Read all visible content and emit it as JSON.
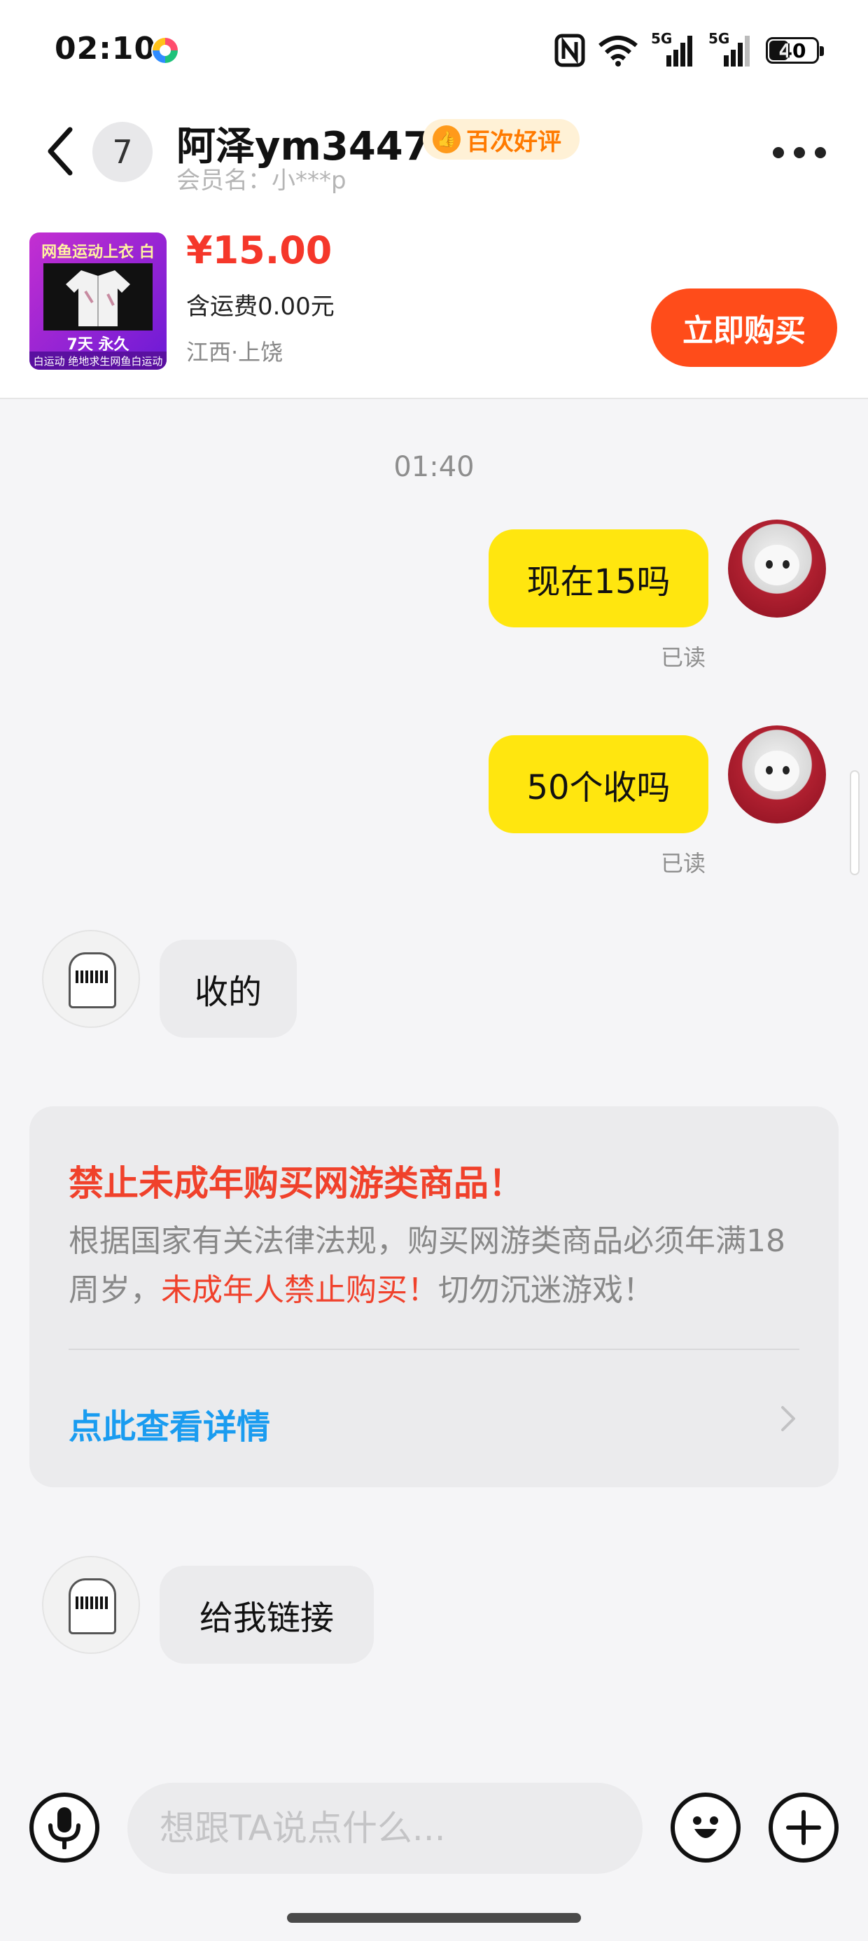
{
  "status_bar": {
    "time": "02:10",
    "battery": "40",
    "network_1": "5G",
    "network_2": "5G",
    "icons": [
      "nfc-icon",
      "wifi-icon",
      "signal-5g-icon",
      "signal-5g-icon",
      "battery-icon"
    ]
  },
  "header": {
    "back_icon": "chevron-left-icon",
    "unread_count": "7",
    "contact_name": "阿泽ym3447",
    "praise_badge": "百次好评",
    "member_name": "会员名：小***p",
    "more_icon": "more-dots-icon"
  },
  "product": {
    "thumb_top": "网鱼运动上衣 白",
    "thumb_mid": "7天  永久",
    "thumb_bottom": "白运动 绝地求生网鱼白运动",
    "price": "¥15.00",
    "shipping": "含运费0.00元",
    "location": "江西·上饶",
    "buy_label": "立即购买"
  },
  "chat": {
    "time": "01:40",
    "messages": [
      {
        "from": "self",
        "text": "现在15吗",
        "read": "已读"
      },
      {
        "from": "self",
        "text": "50个收吗",
        "read": "已读"
      },
      {
        "from": "other",
        "text": "收的"
      },
      {
        "from": "other",
        "text": "给我链接"
      }
    ]
  },
  "notice": {
    "title": "禁止未成年购买网游类商品！",
    "body_before": "根据国家有关法律法规，购买网游类商品必须年满18周岁，",
    "body_highlight": "未成年人禁止购买！",
    "body_after": "切勿沉迷游戏！",
    "link": "点此查看详情"
  },
  "input": {
    "placeholder": "想跟TA说点什么...",
    "value": ""
  },
  "colors": {
    "accent_yellow": "#ffe60f",
    "buy_orange": "#ff4c1a",
    "price_red": "#f5372a",
    "link_blue": "#1a9cf0"
  }
}
